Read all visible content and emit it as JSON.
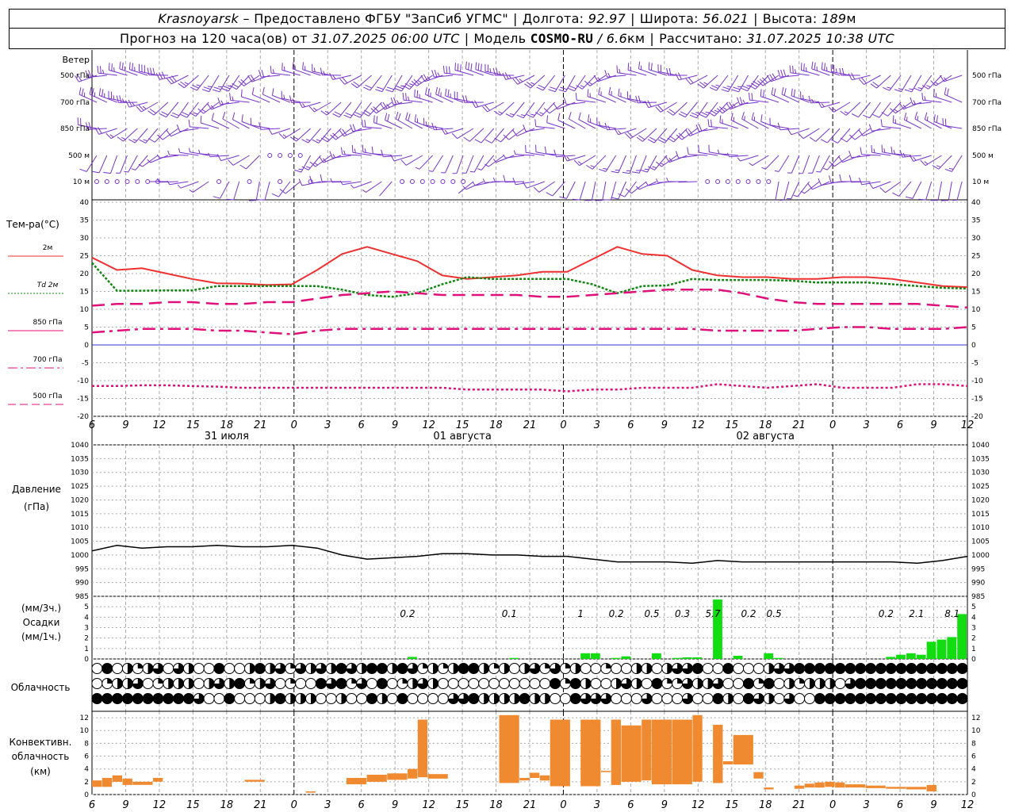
{
  "header": {
    "city": "Krasnoyarsk",
    "dash": "–",
    "provider_label": "Предоставлено ФГБУ \"ЗапСиб УГМС\"",
    "lon_label": "Долгота:",
    "lon_value": "92.97",
    "lat_label": "Широта:",
    "lat_value": "56.021",
    "alt_label": "Высота:",
    "alt_value": "189",
    "alt_unit": "м",
    "forecast_label": "Прогноз на 120 часа(ов) от",
    "forecast_date": "31.07.2025 06:00 UTC",
    "model_label": "Модель",
    "model_name": "COSMO-RU",
    "model_res": "/ 6.6",
    "model_res_unit": "км",
    "calc_label": "Рассчитано:",
    "calc_date": "31.07.2025 10:38 UTC"
  },
  "labels": {
    "wind": "Ветер",
    "wind_levels": [
      "500 гПа",
      "700 гПа",
      "850 гПа",
      "500 м",
      "10  м"
    ],
    "temp_title": "Тем-ра(°С)",
    "temp_legend": [
      "2м",
      "Td  2м",
      "850 гПа",
      "700 гПа",
      "500 гПа"
    ],
    "pressure_title": [
      "Давление",
      "(гПа)"
    ],
    "precip_title": [
      "(мм/3ч.)",
      "Осадки",
      "(мм/1ч.)"
    ],
    "cloud_title": "Облачность",
    "conv_title": [
      "Конвективн.",
      "облачность",
      "(км)"
    ],
    "day_labels": [
      "31 июля",
      "01 августа",
      "02 августа"
    ]
  },
  "colors": {
    "t2m": "#ee3030",
    "td2m": "#118811",
    "t850": "#e0107a",
    "t700": "#e0107a",
    "t500": "#e0107a",
    "zero_line": "#3333cc",
    "wind_barb": "#7733cc",
    "precip": "#11dd11",
    "convective": "#f08a30"
  },
  "chart_data": [
    {
      "type": "line",
      "name": "wind",
      "levels": [
        "500 гПа",
        "700 гПа",
        "850 гПа",
        "500 м",
        "10  м"
      ]
    },
    {
      "type": "line",
      "ylabel": "Тем-ра(°С)",
      "ylim": [
        -20,
        40
      ],
      "yticks": [
        -20,
        -15,
        -10,
        -5,
        0,
        5,
        10,
        15,
        20,
        25,
        30,
        35,
        40
      ],
      "x_hour_ticks": [
        "6",
        "9",
        "12",
        "15",
        "18",
        "21",
        "0",
        "3",
        "6",
        "9",
        "12",
        "15",
        "18",
        "21",
        "0",
        "3",
        "6",
        "9",
        "12",
        "15",
        "18",
        "21",
        "0",
        "3",
        "6",
        "9",
        "12"
      ],
      "x_hours_since_start": [
        0,
        6,
        12,
        18,
        24,
        30,
        36,
        42,
        48,
        54,
        60,
        66,
        72,
        78,
        84,
        90,
        96,
        102,
        108,
        114,
        120,
        126,
        132,
        138,
        144,
        150,
        156
      ],
      "series": [
        {
          "name": "2м",
          "style": "solid",
          "values": [
            24.5,
            21,
            21.5,
            20,
            18.5,
            17.3,
            17.2,
            16.8,
            17,
            21,
            25.5,
            27.5,
            25.5,
            23.5,
            19.5,
            18.5,
            19,
            19.5,
            20.5,
            20.5,
            24,
            27.5,
            25.5,
            25,
            21,
            19.5,
            19,
            19,
            18.5,
            18.5,
            19,
            19,
            18.5,
            17.5,
            16.5,
            16.2
          ]
        },
        {
          "name": "Td  2м",
          "style": "dotted",
          "values": [
            23,
            15.2,
            15.2,
            15.3,
            15.3,
            16.5,
            16.5,
            16.5,
            16.5,
            16.5,
            15.5,
            14,
            13.5,
            14.5,
            17,
            19,
            18.5,
            18.5,
            18.5,
            18.5,
            17,
            14.5,
            16.5,
            16.7,
            18.5,
            18.2,
            18.2,
            18.2,
            18,
            17.5,
            17.5,
            17.5,
            17,
            16.5,
            16,
            15.8
          ]
        },
        {
          "name": "850 гПа",
          "style": "dashed",
          "values": [
            11,
            11.5,
            11.5,
            12,
            12,
            11.5,
            11.5,
            12,
            12,
            13,
            14,
            14.5,
            15,
            14.5,
            14,
            14,
            14,
            14,
            13.5,
            13.5,
            14,
            14.5,
            15,
            15.5,
            15.5,
            15.5,
            14.5,
            13,
            12,
            11.5,
            11.5,
            11.5,
            11.5,
            11.5,
            11,
            10.5
          ]
        },
        {
          "name": "700 гПа",
          "style": "dashdot",
          "values": [
            3.5,
            4,
            4.5,
            4.5,
            4.5,
            4,
            4,
            3.5,
            3,
            4,
            4.5,
            4.5,
            4.5,
            4.5,
            4.5,
            4.5,
            4.5,
            4.5,
            4.5,
            4.5,
            4.5,
            4.5,
            4.5,
            4.5,
            4.5,
            4,
            4,
            4,
            4,
            4.5,
            5,
            5,
            4.5,
            4.5,
            4.5,
            5
          ]
        },
        {
          "name": "500 гПа",
          "style": "dotted",
          "values": [
            -11.5,
            -11.5,
            -11.3,
            -11.3,
            -11.5,
            -11.7,
            -12,
            -12,
            -12,
            -12,
            -12,
            -12,
            -12,
            -12,
            -12,
            -12.5,
            -12.5,
            -12.5,
            -12.5,
            -13,
            -12.5,
            -12.5,
            -12,
            -12,
            -12,
            -11,
            -11.5,
            -12,
            -11.5,
            -11,
            -12,
            -12,
            -12,
            -11,
            -11,
            -11.5
          ]
        }
      ]
    },
    {
      "type": "line",
      "ylabel": "Давление (гПа)",
      "ylim": [
        985,
        1040
      ],
      "yticks": [
        985,
        990,
        995,
        1000,
        1005,
        1010,
        1015,
        1020,
        1025,
        1030,
        1035,
        1040
      ],
      "series": [
        {
          "name": "",
          "values": [
            1001.5,
            1003.5,
            1002.5,
            1003,
            1003,
            1003.5,
            1003,
            1003,
            1003.5,
            1002.5,
            1000,
            998.5,
            999,
            999.5,
            1000.5,
            1000.5,
            1000,
            1000,
            999.5,
            999.5,
            998.5,
            997.5,
            997.5,
            997.5,
            997,
            998,
            997.5,
            997.5,
            997.5,
            997.5,
            997.5,
            997.5,
            997.5,
            997,
            998,
            999.5
          ]
        }
      ]
    },
    {
      "type": "bar",
      "ylabel": "Осадки (мм/1ч.)",
      "ylim": [
        0,
        6
      ],
      "yticks": [
        0,
        1,
        2,
        3,
        4,
        5
      ],
      "three_hour_totals": [
        "0.2",
        "0.1",
        "1",
        "0.2",
        "0.5",
        "0.3",
        "5.7",
        "0.2",
        "0.5",
        "0.2",
        "2.1",
        "8.1"
      ],
      "hourly_bars": [
        [
          31,
          0.2
        ],
        [
          41,
          0.1
        ],
        [
          48,
          0.55
        ],
        [
          49,
          0.55
        ],
        [
          51,
          0.1
        ],
        [
          52,
          0.25
        ],
        [
          55,
          0.55
        ],
        [
          57,
          0.1
        ],
        [
          58,
          0.15
        ],
        [
          59,
          0.15
        ],
        [
          61,
          5.7
        ],
        [
          63,
          0.3
        ],
        [
          66,
          0.55
        ],
        [
          67,
          0.1
        ],
        [
          78,
          0.2
        ],
        [
          79,
          0.4
        ],
        [
          80,
          0.55
        ],
        [
          81,
          0.4
        ],
        [
          82,
          1.65
        ],
        [
          83,
          1.85
        ],
        [
          84,
          2.1
        ],
        [
          85,
          4.3
        ]
      ]
    },
    {
      "type": "table",
      "name": "Облачность",
      "rows": 3
    },
    {
      "type": "bar",
      "ylabel": "Конвективн. облачность (км)",
      "ylim": [
        0,
        13
      ],
      "yticks": [
        0,
        2,
        4,
        6,
        8,
        10,
        12
      ],
      "bars": [
        [
          0,
          1,
          1.2,
          2.2
        ],
        [
          1,
          2,
          1.2,
          2.6
        ],
        [
          2,
          3,
          2,
          3
        ],
        [
          3,
          4,
          1.5,
          2.5
        ],
        [
          4,
          6,
          1.5,
          2
        ],
        [
          6,
          7,
          2,
          2.6
        ],
        [
          15,
          17,
          2,
          2.3
        ],
        [
          21,
          22,
          0.3,
          0.5
        ],
        [
          25,
          27,
          1.6,
          2.6
        ],
        [
          27,
          29,
          2,
          3.1
        ],
        [
          29,
          31,
          2.3,
          3.3
        ],
        [
          31,
          32,
          2.5,
          4
        ],
        [
          32,
          33,
          2.7,
          11.7
        ],
        [
          33,
          35,
          2.5,
          3.2
        ],
        [
          40,
          42,
          1.8,
          12.4
        ],
        [
          42,
          43,
          2.2,
          2.6
        ],
        [
          43,
          44,
          2.6,
          3.4
        ],
        [
          44,
          45,
          2.2,
          3
        ],
        [
          45,
          47,
          1.3,
          11.7
        ],
        [
          48,
          50,
          1.3,
          11.7
        ],
        [
          50,
          51,
          3.5,
          3.7
        ],
        [
          51,
          52,
          1.5,
          11.7
        ],
        [
          52,
          54,
          2,
          10.8
        ],
        [
          54,
          55,
          2.2,
          11.7
        ],
        [
          55,
          57,
          1.6,
          11.7
        ],
        [
          57,
          59,
          1.6,
          11.7
        ],
        [
          59,
          60,
          2,
          12.4
        ],
        [
          61,
          62,
          1.8,
          10.9
        ],
        [
          62,
          63,
          4.7,
          5.2
        ],
        [
          63,
          65,
          4.7,
          9.3
        ],
        [
          65,
          66,
          2.5,
          3.5
        ],
        [
          66,
          67,
          0.8,
          1.1
        ],
        [
          69,
          70,
          0.9,
          1.4
        ],
        [
          70,
          71,
          1.1,
          1.7
        ],
        [
          71,
          72,
          1.1,
          1.9
        ],
        [
          72,
          73,
          1.2,
          2
        ],
        [
          73,
          74,
          1.1,
          1.9
        ],
        [
          74,
          76,
          1.1,
          1.6
        ],
        [
          76,
          78,
          1,
          1.4
        ],
        [
          78,
          80,
          0.9,
          1.2
        ],
        [
          80,
          82,
          0.8,
          1.2
        ],
        [
          82,
          83,
          0.5,
          1.5
        ]
      ]
    }
  ]
}
